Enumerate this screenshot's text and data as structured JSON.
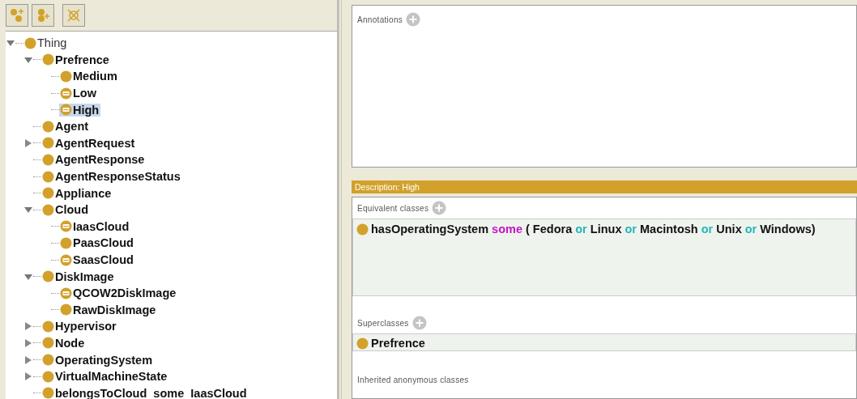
{
  "toolbar": {
    "buttons": [
      {
        "kind": "add-subclass"
      },
      {
        "kind": "add-sibling"
      },
      {
        "kind": "delete"
      }
    ]
  },
  "tree": {
    "nodes": [
      {
        "label": "Thing",
        "kind": "class",
        "expandable": true,
        "expanded": true,
        "selected": false,
        "children": [
          {
            "label": "Prefrence",
            "kind": "class",
            "expandable": true,
            "expanded": true,
            "selected": false,
            "children": [
              {
                "label": "Medium",
                "kind": "class",
                "expandable": false,
                "selected": false
              },
              {
                "label": "Low",
                "kind": "defined",
                "expandable": false,
                "selected": false
              },
              {
                "label": "High",
                "kind": "defined",
                "expandable": false,
                "selected": true
              }
            ]
          },
          {
            "label": "Agent",
            "kind": "class",
            "expandable": false,
            "selected": false
          },
          {
            "label": "AgentRequest",
            "kind": "class",
            "expandable": true,
            "expanded": false,
            "selected": false
          },
          {
            "label": "AgentResponse",
            "kind": "class",
            "expandable": false,
            "selected": false
          },
          {
            "label": "AgentResponseStatus",
            "kind": "class",
            "expandable": false,
            "selected": false
          },
          {
            "label": "Appliance",
            "kind": "class",
            "expandable": false,
            "selected": false
          },
          {
            "label": "Cloud",
            "kind": "class",
            "expandable": true,
            "expanded": true,
            "selected": false,
            "children": [
              {
                "label": "IaasCloud",
                "kind": "defined",
                "expandable": false,
                "selected": false
              },
              {
                "label": "PaasCloud",
                "kind": "class",
                "expandable": false,
                "selected": false
              },
              {
                "label": "SaasCloud",
                "kind": "defined",
                "expandable": false,
                "selected": false
              }
            ]
          },
          {
            "label": "DiskImage",
            "kind": "class",
            "expandable": true,
            "expanded": true,
            "selected": false,
            "children": [
              {
                "label": "QCOW2DiskImage",
                "kind": "defined",
                "expandable": false,
                "selected": false
              },
              {
                "label": "RawDiskImage",
                "kind": "class",
                "expandable": false,
                "selected": false
              }
            ]
          },
          {
            "label": "Hypervisor",
            "kind": "class",
            "expandable": true,
            "expanded": false,
            "selected": false
          },
          {
            "label": "Node",
            "kind": "class",
            "expandable": true,
            "expanded": false,
            "selected": false
          },
          {
            "label": "OperatingSystem",
            "kind": "class",
            "expandable": true,
            "expanded": false,
            "selected": false
          },
          {
            "label": "VirtualMachineState",
            "kind": "class",
            "expandable": true,
            "expanded": false,
            "selected": false
          },
          {
            "label": "belongsToCloud  some  IaasCloud",
            "kind": "class",
            "expandable": false,
            "selected": false
          }
        ]
      }
    ]
  },
  "annotations": {
    "title": "Annotations"
  },
  "description": {
    "title": "Description: High",
    "equivalent_classes": {
      "title": "Equivalent classes",
      "items": [
        {
          "tokens": [
            {
              "text": "hasOperatingSystem",
              "kind": "name"
            },
            {
              "text": "some",
              "kind": "some"
            },
            {
              "text": "( Fedora",
              "kind": "name"
            },
            {
              "text": "or",
              "kind": "or"
            },
            {
              "text": "Linux",
              "kind": "name"
            },
            {
              "text": "or",
              "kind": "or"
            },
            {
              "text": "Macintosh",
              "kind": "name"
            },
            {
              "text": "or",
              "kind": "or"
            },
            {
              "text": "Unix",
              "kind": "name"
            },
            {
              "text": "or",
              "kind": "or"
            },
            {
              "text": "Windows)",
              "kind": "name"
            }
          ]
        }
      ]
    },
    "superclasses": {
      "title": "Superclasses",
      "items": [
        {
          "label": "Prefrence"
        }
      ]
    },
    "inherited": {
      "title": "Inherited anonymous classes"
    }
  }
}
